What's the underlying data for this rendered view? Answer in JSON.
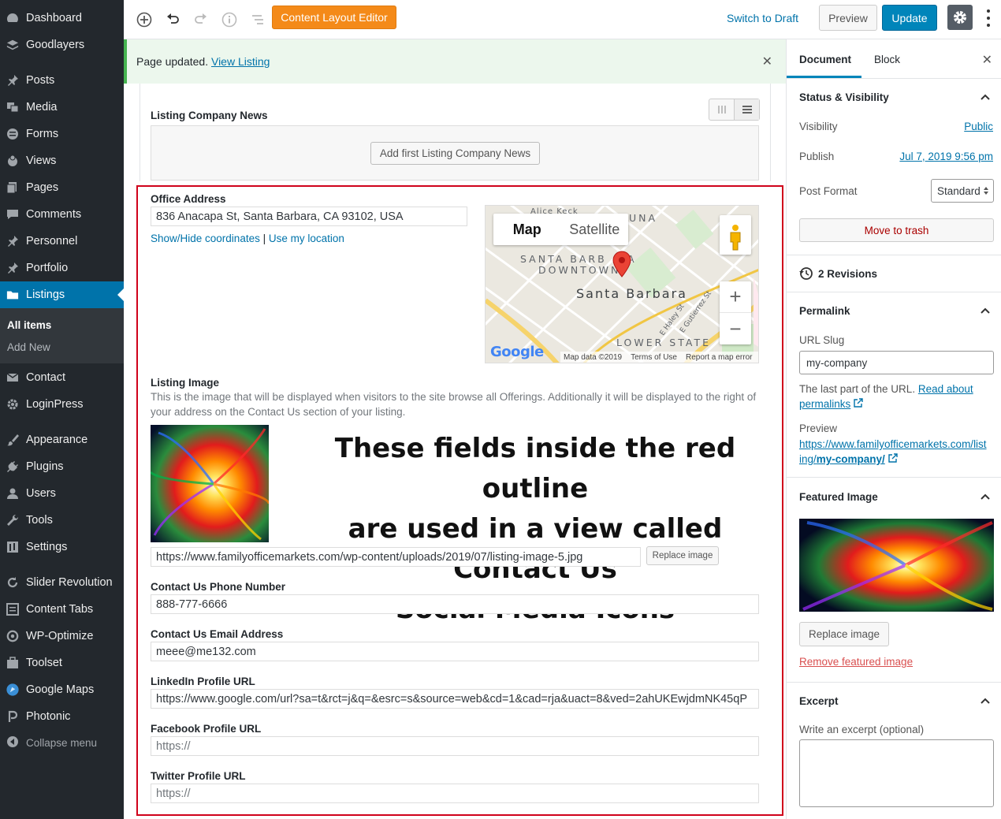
{
  "admin_menu": {
    "items": [
      {
        "label": "Dashboard",
        "icon": "dashboard-icon"
      },
      {
        "label": "Goodlayers",
        "icon": "goodlayers-icon"
      },
      {
        "label": "Posts",
        "icon": "pin-icon"
      },
      {
        "label": "Media",
        "icon": "media-icon"
      },
      {
        "label": "Forms",
        "icon": "forms-icon"
      },
      {
        "label": "Views",
        "icon": "views-icon"
      },
      {
        "label": "Pages",
        "icon": "pages-icon"
      },
      {
        "label": "Comments",
        "icon": "comment-icon"
      },
      {
        "label": "Personnel",
        "icon": "pin-icon"
      },
      {
        "label": "Portfolio",
        "icon": "pin-icon"
      },
      {
        "label": "Listings",
        "icon": "folder-icon"
      },
      {
        "label": "Contact",
        "icon": "mail-icon"
      },
      {
        "label": "LoginPress",
        "icon": "gear-icon"
      },
      {
        "label": "Appearance",
        "icon": "brush-icon"
      },
      {
        "label": "Plugins",
        "icon": "plug-icon"
      },
      {
        "label": "Users",
        "icon": "user-icon"
      },
      {
        "label": "Tools",
        "icon": "wrench-icon"
      },
      {
        "label": "Settings",
        "icon": "settings-icon"
      },
      {
        "label": "Slider Revolution",
        "icon": "refresh-icon"
      },
      {
        "label": "Content Tabs",
        "icon": "list-icon"
      },
      {
        "label": "WP-Optimize",
        "icon": "optimize-icon"
      },
      {
        "label": "Toolset",
        "icon": "toolbox-icon"
      },
      {
        "label": "Google Maps",
        "icon": "maps-icon"
      },
      {
        "label": "Photonic",
        "icon": "photonic-icon"
      }
    ],
    "submenu": [
      "All items",
      "Add New"
    ],
    "collapse": "Collapse menu"
  },
  "toolbar": {
    "content_layout_editor": "Content Layout Editor",
    "switch_draft": "Switch to Draft",
    "preview": "Preview",
    "update": "Update"
  },
  "notice": {
    "text": "Page updated.",
    "link": "View Listing"
  },
  "editor": {
    "news_label": "Listing Company News",
    "news_button": "Add first Listing Company News",
    "office_label": "Office Address",
    "office_value": "836 Anacapa St, Santa Barbara, CA 93102, USA",
    "show_hide": "Show/Hide coordinates",
    "divider": "|",
    "use_location": "Use my location",
    "map": {
      "btn_map": "Map",
      "btn_satellite": "Satellite",
      "city": "Santa Barbara",
      "area1": "SANTA BARB",
      "area1b": "A",
      "area2": "DOWNTOWN",
      "area3": "LOWER STATE",
      "area4": "UNA",
      "street1": "E Haley St",
      "street2": "E Gutierrez St",
      "top": "Alice Keck",
      "google": "Google",
      "data": "Map data ©2019",
      "terms": "Terms of Use",
      "report": "Report a map error"
    },
    "image_label": "Listing Image",
    "image_desc": "This is the image that will be displayed when visitors to the site browse all Offerings. Additionally it will be displayed to the right of your address on the Contact Us section of your listing.",
    "overlay_text": [
      "These fields inside the red outline",
      "are used in a view called Contact Us",
      "Social Media Icons"
    ],
    "image_url": "https://www.familyofficemarkets.com/wp-content/uploads/2019/07/listing-image-5.jpg",
    "replace_image": "Replace image",
    "phone_label": "Contact Us Phone Number",
    "phone_value": "888-777-6666",
    "email_label": "Contact Us Email Address",
    "email_value": "meee@me132.com",
    "linkedin_label": "LinkedIn Profile URL",
    "linkedin_value": "https://www.google.com/url?sa=t&rct=j&q=&esrc=s&source=web&cd=1&cad=rja&uact=8&ved=2ahUKEwjdmNK45qP",
    "facebook_label": "Facebook Profile URL",
    "facebook_placeholder": "https://",
    "twitter_label": "Twitter Profile URL",
    "twitter_placeholder": "https://"
  },
  "sidebar": {
    "tab_document": "Document",
    "tab_block": "Block",
    "status_title": "Status & Visibility",
    "visibility_label": "Visibility",
    "visibility_value": "Public",
    "publish_label": "Publish",
    "publish_value": "Jul 7, 2019 9:56 pm",
    "format_label": "Post Format",
    "format_value": "Standard",
    "trash": "Move to trash",
    "revisions": "2 Revisions",
    "permalink_title": "Permalink",
    "slug_label": "URL Slug",
    "slug_value": "my-company",
    "slug_help": "The last part of the URL.",
    "read_about": "Read about",
    "permalinks": "permalinks",
    "preview_label": "Preview",
    "preview_url": "https://www.familyofficemarkets.com/list",
    "preview_url2": "ing/",
    "preview_url3": "my-company/",
    "featured_title": "Featured Image",
    "replace_image": "Replace image",
    "remove_image": "Remove featured image",
    "excerpt_title": "Excerpt",
    "excerpt_label": "Write an excerpt (optional)"
  },
  "colors": {
    "accent": "#0073aa",
    "menu_bg": "#23282d",
    "highlight": "#d0021b",
    "orange": "#f48a19"
  }
}
